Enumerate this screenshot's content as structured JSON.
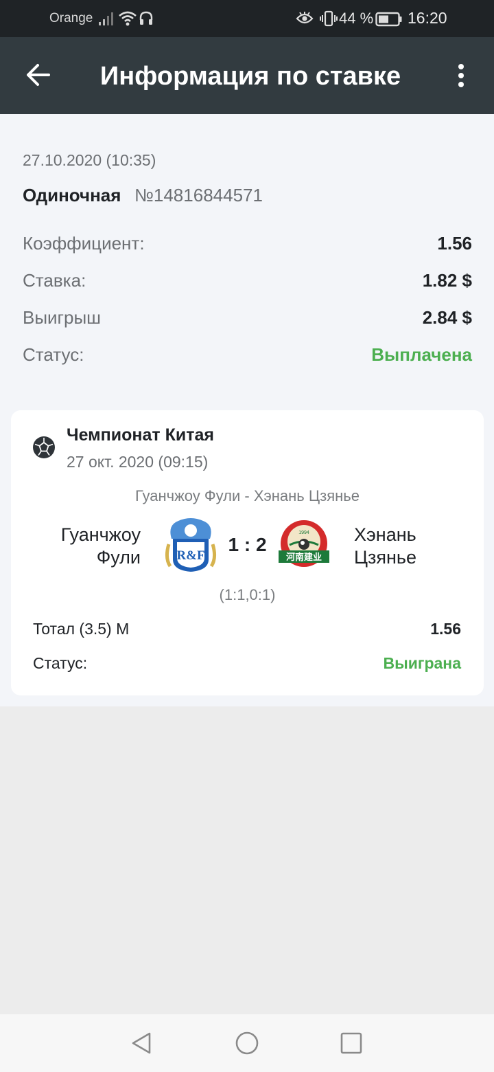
{
  "status_bar": {
    "carrier": "Orange",
    "battery_percent": "44 %",
    "time": "16:20",
    "icons": [
      "signal-icon",
      "wifi-icon",
      "headset-icon",
      "eye-icon",
      "vibrate-icon",
      "battery-icon"
    ]
  },
  "app_bar": {
    "title": "Информация по ставке",
    "icons": [
      "back-arrow-icon",
      "more-vert-icon"
    ]
  },
  "bet": {
    "date": "27.10.2020 (10:35)",
    "type": "Одиночная",
    "number": "№14816844571",
    "rows": [
      {
        "label": "Коэффициент:",
        "value": "1.56"
      },
      {
        "label": "Ставка:",
        "value": "1.82 $"
      },
      {
        "label": "Выигрыш",
        "value": "2.84 $"
      },
      {
        "label": "Статус:",
        "value": "Выплачена"
      }
    ]
  },
  "event": {
    "sport_icon": "soccer-ball-icon",
    "league": "Чемпионат Китая",
    "date": "27 окт. 2020 (09:15)",
    "match_title": "Гуанчжоу Фули - Хэнань Цзянье",
    "team1": {
      "name_line1": "Гуанчжоу",
      "name_line2": "Фули",
      "logo_text": "R&F"
    },
    "team2": {
      "name_line1": "Хэнань",
      "name_line2": "Цзянье",
      "logo_text": "河南建业",
      "logo_year": "1994"
    },
    "score": "1 : 2",
    "halves": "(1:1,0:1)",
    "market": "Тотал (3.5) М",
    "market_odd": "1.56",
    "status_label": "Статус:",
    "status_value": "Выиграна"
  },
  "colors": {
    "status_bar_bg": "#1f2326",
    "app_bar_bg": "#323b40",
    "success_green": "#4caf50",
    "info_bg": "#f3f5f9"
  },
  "nav_bar": {
    "icons": [
      "nav-back-icon",
      "nav-home-icon",
      "nav-recents-icon"
    ]
  }
}
